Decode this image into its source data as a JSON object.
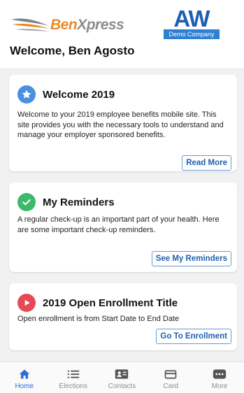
{
  "brand": {
    "name_part1": "Ben",
    "name_part2": "Xpress",
    "company_letters": "AW",
    "company_tag": "Demo Company"
  },
  "page_title": "Welcome, Ben Agosto",
  "cards": [
    {
      "title": "Welcome 2019",
      "icon": "star-icon",
      "icon_color": "#4a8fe0",
      "body": "Welcome to your 2019 employee benefits mobile site. This site provides you with the necessary tools to understand and manage your employer sponsored benefits.",
      "button": "Read More"
    },
    {
      "title": "My Reminders",
      "icon": "checkmark-icon",
      "icon_color": "#3cb96a",
      "body": "A regular check-up is an important part of your health. Here are some important check-up reminders.",
      "button": "See My Reminders"
    },
    {
      "title": "2019 Open Enrollment Title",
      "icon": "play-icon",
      "icon_color": "#e54b55",
      "body": "Open enrollment is from Start Date to End Date",
      "button": "Go To Enrollment"
    }
  ],
  "tabs": [
    {
      "label": "Home",
      "icon": "home-icon",
      "active": true
    },
    {
      "label": "Elections",
      "icon": "list-icon",
      "active": false
    },
    {
      "label": "Contacts",
      "icon": "contact-card-icon",
      "active": false
    },
    {
      "label": "Card",
      "icon": "card-icon",
      "active": false
    },
    {
      "label": "More",
      "icon": "more-icon",
      "active": false
    }
  ],
  "colors": {
    "accent": "#2d6bd6",
    "button_text": "#1f5fae",
    "brand_orange": "#e98a2a",
    "brand_gray": "#8a8c8f",
    "company_blue": "#1d5fb5"
  }
}
